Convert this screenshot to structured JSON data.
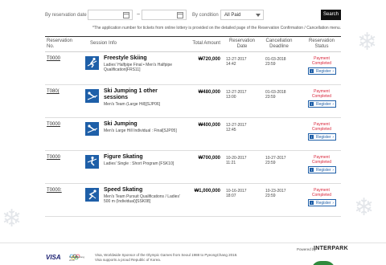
{
  "filter": {
    "date_label": "By reservation date",
    "date_from": "",
    "date_to": "",
    "date_separator": "~",
    "condition_label": "By condition",
    "condition_value": "All Paid",
    "search_label": "Search"
  },
  "notice": "*The application number for tickets from online lottery is provided on the detailed page of the Reservation Confirmation / Cancellation menu.",
  "table": {
    "headers": {
      "reservation_no": "Reservation No.",
      "session_info": "Session Info",
      "total_amount": "Total Amount",
      "reservation_date": "Reservation Date",
      "cancellation_deadline": "Cancellation Deadline",
      "reservation_status": "Reservation Status"
    },
    "rows": [
      {
        "no": "T0000",
        "pictogram": "freestyle-skiing-icon",
        "title": "Freestyle Skiing",
        "detail": "Ladies' Halfpipe Final • Men's Halfpipe Qualification[FRS11]",
        "amount": "₩720,000",
        "res_date": "12-27-2017",
        "res_time": "14:42",
        "cancel_date": "01-03-2018",
        "cancel_time": "23:59",
        "status_1": "Payment",
        "status_2": "Completed",
        "register": "Register"
      },
      {
        "no": "T080(",
        "pictogram": "ski-jumping-icon",
        "title": "Ski Jumping 1 other sessions",
        "detail": "Men's Team (Large Hill)[SJP06]",
        "amount": "₩480,000",
        "res_date": "12-27-2017",
        "res_time": "13:00",
        "cancel_date": "01-03-2018",
        "cancel_time": "23:59",
        "status_1": "Payment",
        "status_2": "Completed",
        "register": "Register"
      },
      {
        "no": "T0000",
        "pictogram": "ski-jumping-icon",
        "title": "Ski Jumping",
        "detail": "Men's Large Hill Individual : Final[SJP05]",
        "amount": "₩400,000",
        "res_date": "12-27-2017",
        "res_time": "12:45",
        "cancel_date": "",
        "cancel_time": "",
        "status_1": "Payment",
        "status_2": "Completed",
        "register": "Register"
      },
      {
        "no": "T0000",
        "pictogram": "figure-skating-icon",
        "title": "Figure Skating",
        "detail": "Ladies' Single : Short Program [FSK10]",
        "amount": "₩700,000",
        "res_date": "10-20-2017",
        "res_time": "11:21",
        "cancel_date": "10-27-2017",
        "cancel_time": "23:59",
        "status_1": "Payment",
        "status_2": "Completed",
        "register": "Register"
      },
      {
        "no": "T0000:",
        "pictogram": "speed-skating-icon",
        "title": "Speed Skating",
        "detail": "Men's Team Pursuit Qualifications / Ladies' 500 m (Individual)[SSK08]",
        "amount": "₩1,000,000",
        "res_date": "10-16-2017",
        "res_time": "18:07",
        "cancel_date": "10-23-2017",
        "cancel_time": "23:59",
        "status_1": "Payment",
        "status_2": "Completed",
        "register": "Register"
      }
    ]
  },
  "footer": {
    "visa": "VISA",
    "olympic_caption": "PyeongChang 2018",
    "line1": "Visa, Worldwide Sponsor of the Olympic Games from Seoul 1988 to PyeongChang 2018.",
    "line2": "Visa supports a proud Republic of Korea.",
    "powered": "Powered by",
    "partner": "INTERPARK"
  },
  "colors": {
    "accent_blue": "#1e5fa8",
    "status_red": "#d9263b",
    "search_bg": "#111111"
  }
}
